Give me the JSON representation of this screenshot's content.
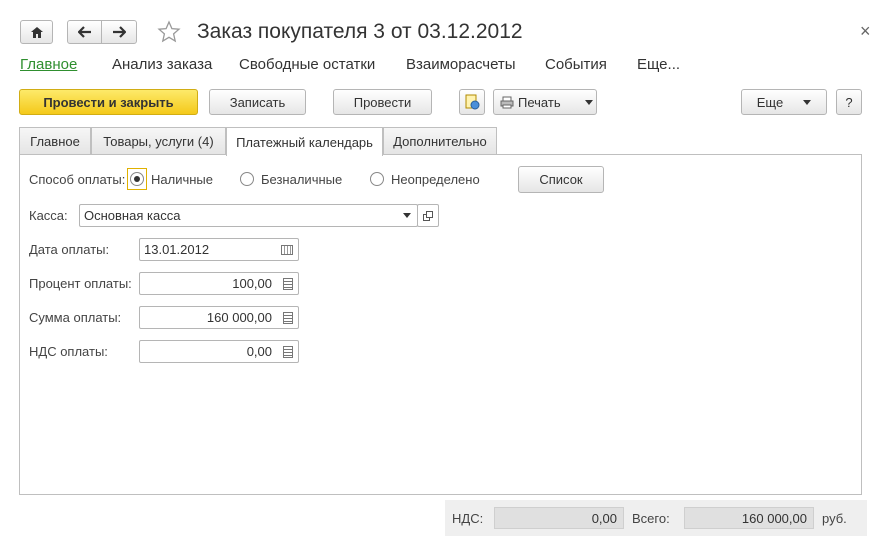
{
  "window": {
    "title": "Заказ покупателя 3 от 03.12.2012",
    "close_glyph": "×"
  },
  "nav": {
    "items": [
      "Главное",
      "Анализ заказа",
      "Свободные остатки",
      "Взаиморасчеты",
      "События",
      "Еще..."
    ]
  },
  "toolbar": {
    "post_close": "Провести и закрыть",
    "save": "Записать",
    "post": "Провести",
    "print": "Печать",
    "more": "Еще",
    "help": "?"
  },
  "tabs": [
    "Главное",
    "Товары, услуги (4)",
    "Платежный календарь",
    "Дополнительно"
  ],
  "form": {
    "payment_method_label": "Способ оплаты:",
    "payment_options": [
      "Наличные",
      "Безналичные",
      "Неопределено"
    ],
    "list_button": "Список",
    "cashbox_label": "Касса:",
    "cashbox_value": "Основная касса",
    "date_label": "Дата оплаты:",
    "date_value": "13.01.2012",
    "percent_label": "Процент оплаты:",
    "percent_value": "100,00",
    "amount_label": "Сумма оплаты:",
    "amount_value": "160 000,00",
    "vat_label": "НДС оплаты:",
    "vat_value": "0,00"
  },
  "footer": {
    "vat_label": "НДС:",
    "vat_value": "0,00",
    "total_label": "Всего:",
    "total_value": "160 000,00",
    "currency": "руб."
  },
  "colors": {
    "accent_green": "#2f8f2f",
    "primary_button": "#f4c91a"
  }
}
